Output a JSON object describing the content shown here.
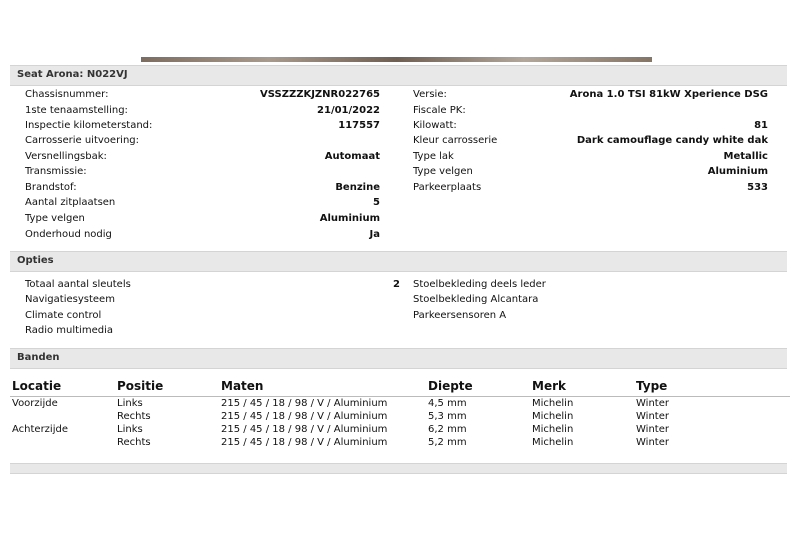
{
  "vehicle_section": {
    "title": "Seat Arona: N022VJ",
    "left": [
      {
        "label": "Chassisnummer:",
        "value": "VSSZZZKJZNR022765"
      },
      {
        "label": "1ste tenaamstelling:",
        "value": "21/01/2022"
      },
      {
        "label": "Inspectie kilometerstand:",
        "value": "117557"
      },
      {
        "label": "Carrosserie uitvoering:",
        "value": ""
      },
      {
        "label": "Versnellingsbak:",
        "value": "Automaat"
      },
      {
        "label": "Transmissie:",
        "value": ""
      },
      {
        "label": "Brandstof:",
        "value": "Benzine"
      },
      {
        "label": "Aantal zitplaatsen",
        "value": "5"
      },
      {
        "label": "Type velgen",
        "value": "Aluminium"
      },
      {
        "label": "Onderhoud nodig",
        "value": "Ja"
      }
    ],
    "right": [
      {
        "label": "Versie:",
        "value": "Arona 1.0 TSI 81kW Xperience DSG"
      },
      {
        "label": "Fiscale PK:",
        "value": ""
      },
      {
        "label": "Kilowatt:",
        "value": "81"
      },
      {
        "label": "Kleur carrosserie",
        "value": "Dark camouflage candy white dak"
      },
      {
        "label": "Type lak",
        "value": "Metallic"
      },
      {
        "label": "Type velgen",
        "value": "Aluminium"
      },
      {
        "label": "Parkeerplaats",
        "value": "533"
      }
    ]
  },
  "options_section": {
    "title": "Opties",
    "left": [
      {
        "label": "Totaal aantal sleutels",
        "value": "2"
      },
      {
        "label": "Navigatiesysteem",
        "value": ""
      },
      {
        "label": "Climate control",
        "value": ""
      },
      {
        "label": "Radio multimedia",
        "value": ""
      }
    ],
    "right": [
      {
        "label": "Stoelbekleding deels leder",
        "value": ""
      },
      {
        "label": "Stoelbekleding Alcantara",
        "value": ""
      },
      {
        "label": "Parkeersensoren A",
        "value": ""
      }
    ]
  },
  "tires_section": {
    "title": "Banden",
    "columns": [
      "Locatie",
      "Positie",
      "Maten",
      "Diepte",
      "Merk",
      "Type"
    ],
    "rows": [
      [
        "Voorzijde",
        "Links",
        "215 / 45 / 18 / 98 / V / Aluminium",
        "4,5 mm",
        "Michelin",
        "Winter"
      ],
      [
        "",
        "Rechts",
        "215 / 45 / 18 / 98 / V / Aluminium",
        "5,3 mm",
        "Michelin",
        "Winter"
      ],
      [
        "Achterzijde",
        "Links",
        "215 / 45 / 18 / 98 / V / Aluminium",
        "6,2 mm",
        "Michelin",
        "Winter"
      ],
      [
        "",
        "Rechts",
        "215 / 45 / 18 / 98 / V / Aluminium",
        "5,2 mm",
        "Michelin",
        "Winter"
      ]
    ]
  }
}
